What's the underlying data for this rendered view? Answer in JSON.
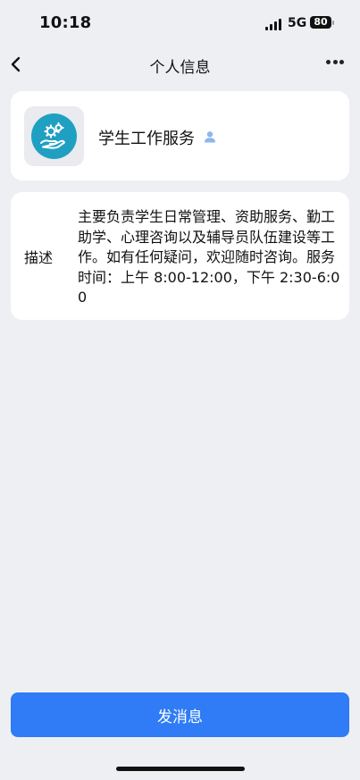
{
  "status_bar": {
    "time": "10:18",
    "network": "5G",
    "battery": "80"
  },
  "nav": {
    "title": "个人信息",
    "back_icon": "chevron-left-icon",
    "more_icon": "more-dots-icon"
  },
  "profile": {
    "name": "学生工作服务",
    "avatar_icon": "gears-hand-icon",
    "badge_icon": "person-icon",
    "avatar_color": "#1fa0c2"
  },
  "description": {
    "label": "描述",
    "text": "主要负责学生日常管理、资助服务、勤工助学、心理咨询以及辅导员队伍建设等工作。如有任何疑问，欢迎随时咨询。服务时间：上午 8:00-12:00，下午 2:30-6:00"
  },
  "actions": {
    "send_label": "发消息",
    "accent": "#2f7cf6"
  }
}
